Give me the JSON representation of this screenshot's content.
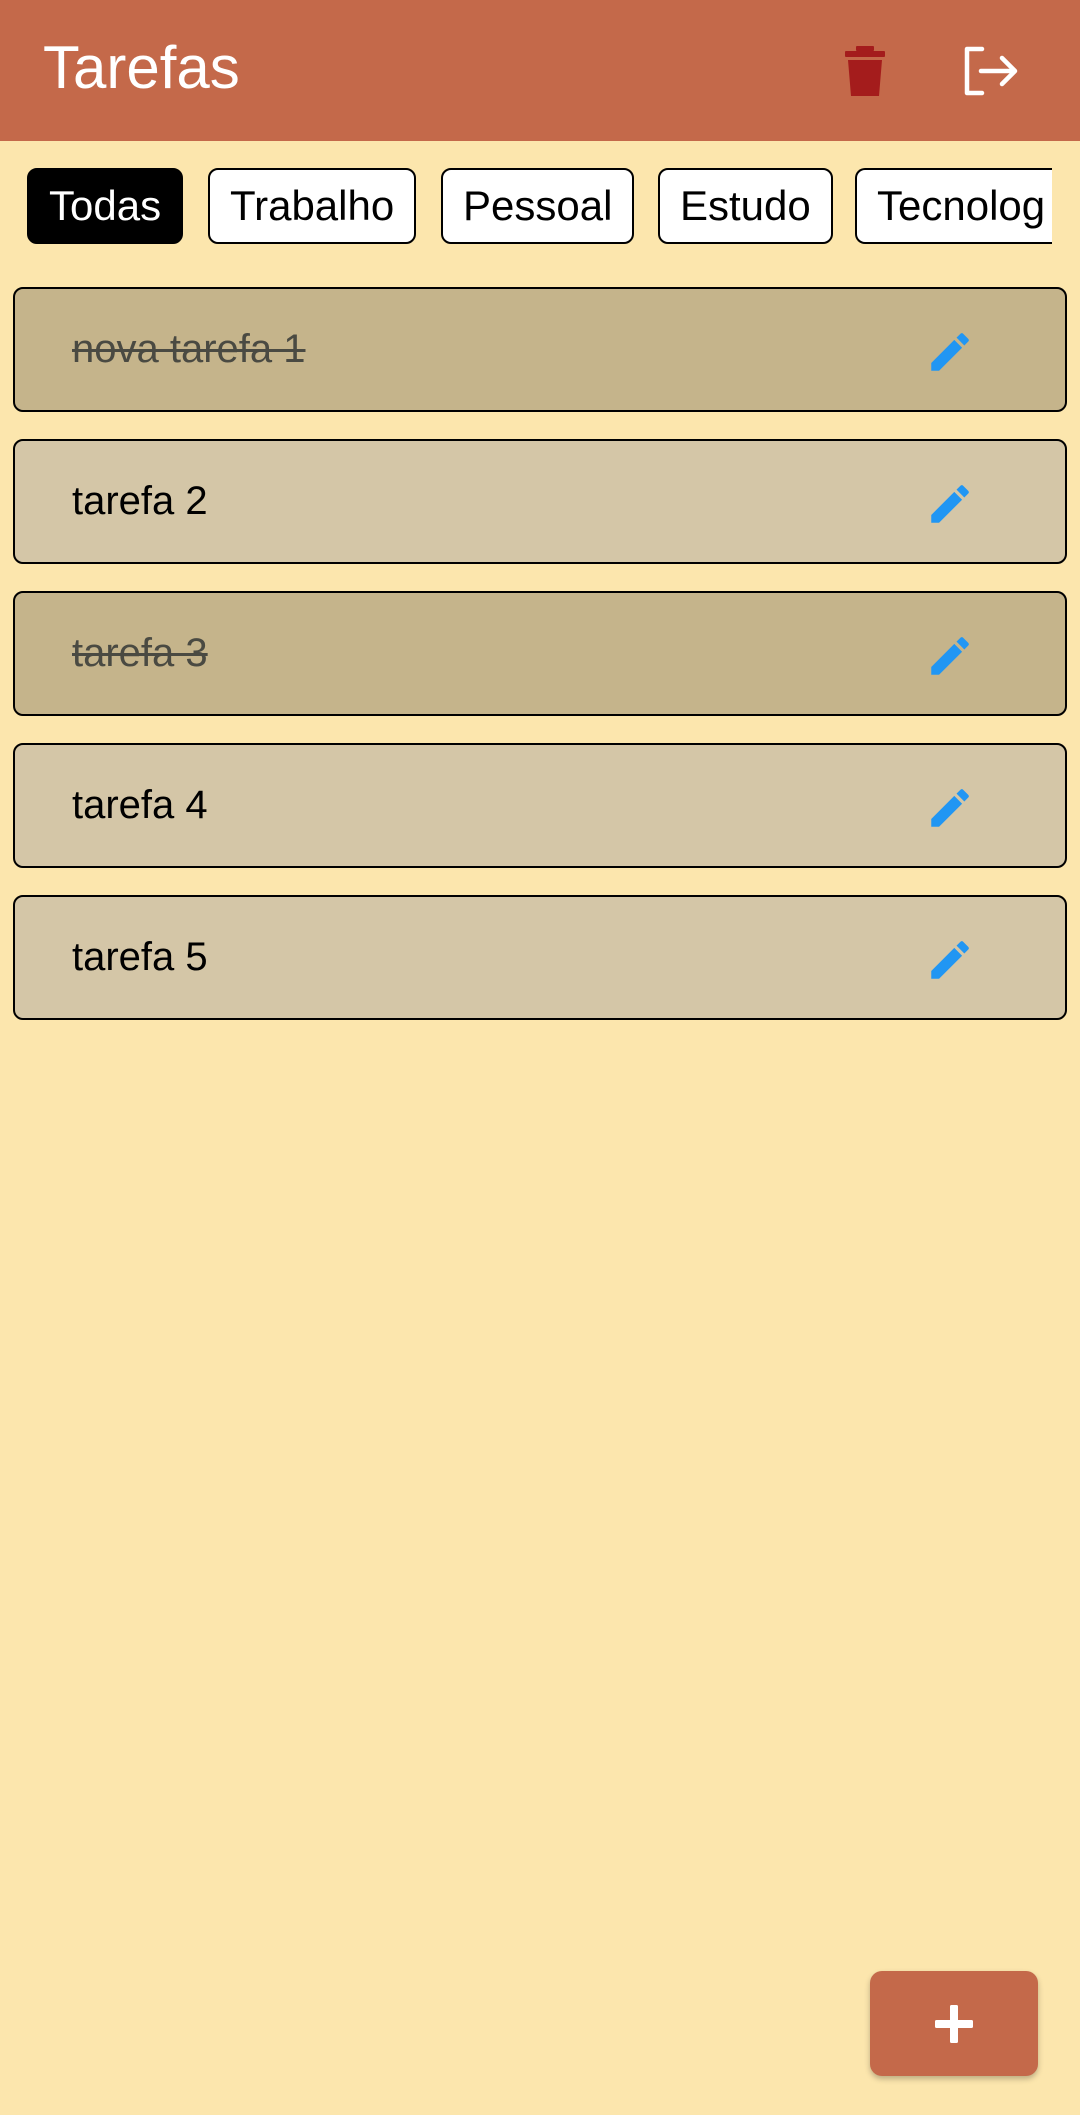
{
  "appbar": {
    "title": "Tarefas",
    "actions": [
      {
        "icon": "trash-icon",
        "color": "#a41c1c"
      },
      {
        "icon": "logout-icon",
        "color": "#ffffff"
      }
    ]
  },
  "filters": {
    "selected": "Todas",
    "items": [
      "Todas",
      "Trabalho",
      "Pessoal",
      "Estudo",
      "Tecnolog"
    ]
  },
  "tasks": [
    {
      "label": "nova tarefa 1",
      "done": true
    },
    {
      "label": "tarefa 2",
      "done": false
    },
    {
      "label": "tarefa 3",
      "done": true
    },
    {
      "label": "tarefa 4",
      "done": false
    },
    {
      "label": "tarefa 5",
      "done": false
    }
  ],
  "fab": {
    "icon": "plus-icon"
  },
  "colors": {
    "primary": "#c4694a",
    "background": "#fce6ad",
    "task": "#d4c6a7",
    "task_done": "#c5b48b",
    "edit_icon": "#2196f3",
    "delete_icon": "#a41c1c"
  }
}
